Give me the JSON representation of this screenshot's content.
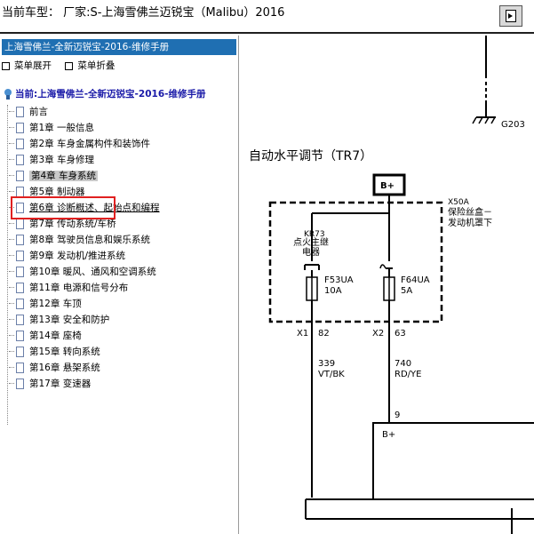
{
  "window": {
    "title": "当前车型： 厂家:S-上海雪佛兰迈锐宝（Malibu）2016"
  },
  "sidebar": {
    "header": "上海雪佛兰-全新迈锐宝-2016-维修手册",
    "toolbar": {
      "expand": "菜单展开",
      "collapse": "菜单折叠"
    },
    "root": "当前:上海雪佛兰-全新迈锐宝-2016-维修手册",
    "items": [
      {
        "label": "前言"
      },
      {
        "label": "第1章  一般信息"
      },
      {
        "label": "第2章  车身金属构件和装饰件"
      },
      {
        "label": "第3章  车身修理"
      },
      {
        "label": "第4章  车身系统"
      },
      {
        "label": "第5章  制动器"
      },
      {
        "label": "第6章  诊断概述、起始点和编程"
      },
      {
        "label": "第7章  传动系统/车桥"
      },
      {
        "label": "第8章  驾驶员信息和娱乐系统"
      },
      {
        "label": "第9章  发动机/推进系统"
      },
      {
        "label": "第10章  暖风、通风和空调系统"
      },
      {
        "label": "第11章  电源和信号分布"
      },
      {
        "label": "第12章  车顶"
      },
      {
        "label": "第13章  安全和防护"
      },
      {
        "label": "第14章  座椅"
      },
      {
        "label": "第15章  转向系统"
      },
      {
        "label": "第16章  悬架系统"
      },
      {
        "label": "第17章  变速器"
      }
    ],
    "selected_index": 4
  },
  "diagram": {
    "ground_label": "G203",
    "title": "自动水平调节（TR7）",
    "battery_label": "B+",
    "fuse_box_label_line1": "X50A",
    "fuse_box_label_line2": "保险丝盒－",
    "fuse_box_label_line3": "发动机罩下",
    "relay_label_line1": "KR73",
    "relay_label_line2": "点火主继",
    "relay_label_line3": "电器",
    "fuse1_name": "F53UA",
    "fuse1_rating": "10A",
    "fuse2_name": "F64UA",
    "fuse2_rating": "5A",
    "connector1": "X1",
    "pin1": "82",
    "connector2": "X2",
    "pin2": "63",
    "wire1_number": "339",
    "wire1_color": "VT/BK",
    "wire2_number": "740",
    "wire2_color": "RD/YE",
    "module_pin": "9",
    "module_label": "B+"
  }
}
